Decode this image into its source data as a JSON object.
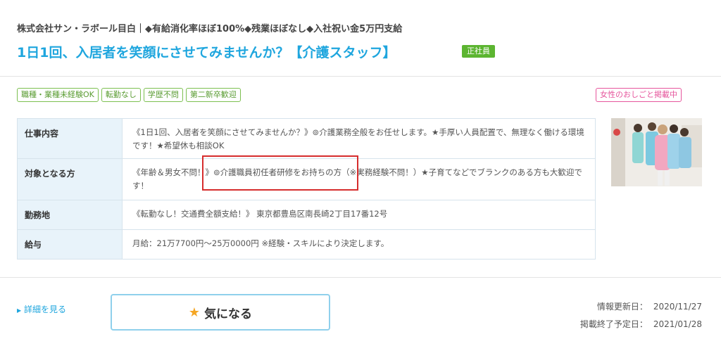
{
  "header": {
    "company_line": "株式会社サン・ラボール目白｜◆有給消化率ほぼ100%◆残業ほぼなし◆入社祝い金5万円支給",
    "job_title": "1日1回、入居者を笑顔にさせてみませんか？【介護スタッフ】",
    "employment_type": "正社員"
  },
  "tags": [
    "職種・業種未経験OK",
    "転勤なし",
    "学歴不問",
    "第二新卒歓迎"
  ],
  "pink_tag": "女性のおしごと掲載中",
  "info_rows": [
    {
      "label": "仕事内容",
      "value": "《1日1回、入居者を笑顔にさせてみませんか？》⊚介護業務全般をお任せします。★手厚い人員配置で、無理なく働ける環境です！★希望休も相談OK"
    },
    {
      "label": "対象となる方",
      "value": "《年齢＆男女不問！》⊚介護職員初任者研修をお持ちの方（※実務経験不問！）★子育てなどでブランクのある方も大歓迎です！"
    },
    {
      "label": "勤務地",
      "value": "《転勤なし！交通費全額支給！》 東京都豊島区南長崎2丁目17番12号"
    },
    {
      "label": "給与",
      "value": "月給：21万7700円～25万0000円 ※経験・スキルにより決定します。"
    }
  ],
  "footer": {
    "detail_link": "詳細を見る",
    "favorite_label": "気になる",
    "updated_label": "情報更新日：",
    "updated_date": "2020/11/27",
    "end_label": "掲載終了予定日：",
    "end_date": "2021/01/28"
  },
  "colors": {
    "accent": "#1fa6de",
    "badge_green": "#5cb531",
    "pink": "#e6559c",
    "highlight_red": "#d62d2d",
    "star": "#f5a623"
  },
  "icons": {
    "detail_arrow": "triangle-right-icon",
    "favorite": "star-icon"
  }
}
